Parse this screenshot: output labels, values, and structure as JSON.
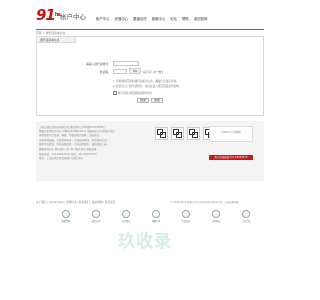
{
  "header": {
    "logo": "91",
    "title": "帐户中心",
    "nav": [
      "帐户中心",
      "充值中心",
      "渠道合作",
      "客服中心",
      "论坛",
      "帮助",
      "返回官网"
    ]
  },
  "breadcrumb": "首页 > 通行证基本信息",
  "panel": {
    "tab": "通行证基本信息",
    "fields": [
      {
        "label": "请输入通行证帐号：",
        "value": ""
      },
      {
        "label": "验证码：",
        "value": ""
      }
    ],
    "captcha_text": "8G",
    "captcha_hint": "看不清？换个数字",
    "notes": [
      "1. 请准确填写您的通行证帐号信息，确保信息真实有效。",
      "2. 如您忘记了帐号或密码，请点此进入找回页面进行操作。"
    ],
    "checkbox_label": "我已阅读并同意相关服务条款",
    "buttons": [
      "提交",
      "重置"
    ]
  },
  "footer": {
    "info_lines": [
      "上海九城信息科技有限公司 版权所有  沪ICP备05003498号",
      "网络文化经营许可证 沪网文[2008]010-号  增值电信业务经营许可证",
      "未经授权禁止转载、摘编、复制或建立镜像，违者必究。",
      "适度游戏益脑，沉迷游戏伤身，合理安排时间，享受健康生活。",
      "抵制不良游戏，拒绝盗版游戏，注意自我保护，谨防受骗上当。",
      "健康游戏忠告 家长监护工程 用户服务协议 隐私政策",
      "客服电话：021-62063078  传真：021-62063079",
      "地址：上海市徐汇区虹桥路1号港汇中心"
    ],
    "badge_text": "CNNIC 可信网站",
    "red_bar": "用户咨询热线 021-62063078",
    "links": "关于我们 | About Spes | 招聘信息 | 联系我们 | 站点地图 | 意见反馈",
    "copyright": "© 2003-2012 Spes.com All Rights Reserved. 上海久游网络",
    "seals": [
      "网络警察",
      "诚信认证",
      "可信网站",
      "网络110",
      "不良信息",
      "文明网站",
      "上海工商"
    ]
  },
  "watermark": "玖收录"
}
